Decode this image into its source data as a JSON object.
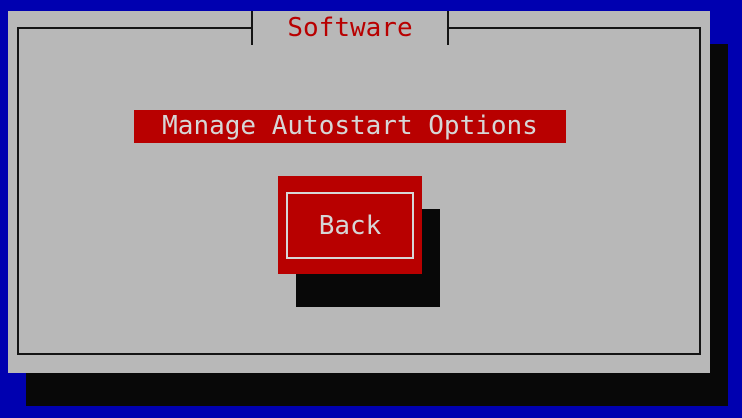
{
  "dialog": {
    "title": "Software",
    "menu_items": [
      {
        "label": "Manage Autostart Options",
        "selected": true
      }
    ],
    "buttons": {
      "back_label": "Back"
    }
  },
  "colors": {
    "background": "#0000b0",
    "dialog": "#b8b8b8",
    "accent": "#b80000",
    "accent_text": "#d6d6d6",
    "shadow": "#080808"
  }
}
